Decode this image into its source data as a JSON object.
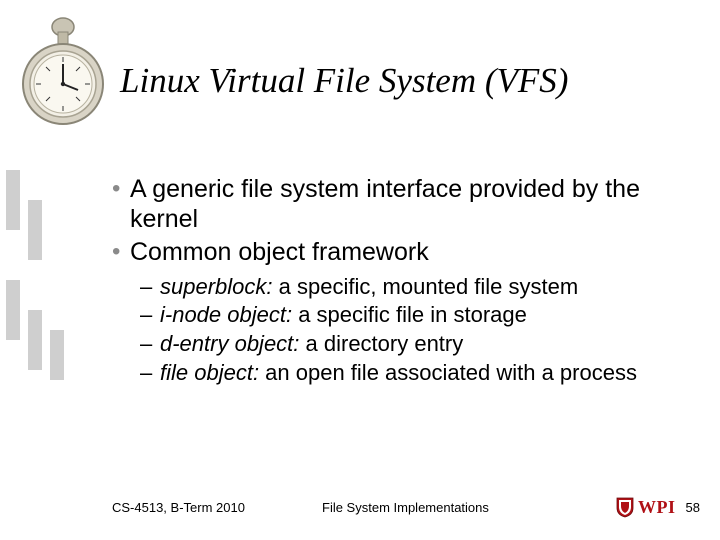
{
  "title": "Linux Virtual File System (VFS)",
  "bullets": [
    "A generic file system interface provided by the kernel",
    "Common object framework"
  ],
  "subbullets": [
    {
      "term": "superblock:",
      "desc": " a specific, mounted file system"
    },
    {
      "term": "i-node object:",
      "desc": " a specific file in storage"
    },
    {
      "term": "d-entry object:",
      "desc": " a directory entry"
    },
    {
      "term": "file object:",
      "desc": " an open file associated with a process"
    }
  ],
  "footer": {
    "left": "CS-4513, B-Term 2010",
    "center": "File System Implementations",
    "logo_text": "WPI",
    "page": "58"
  }
}
